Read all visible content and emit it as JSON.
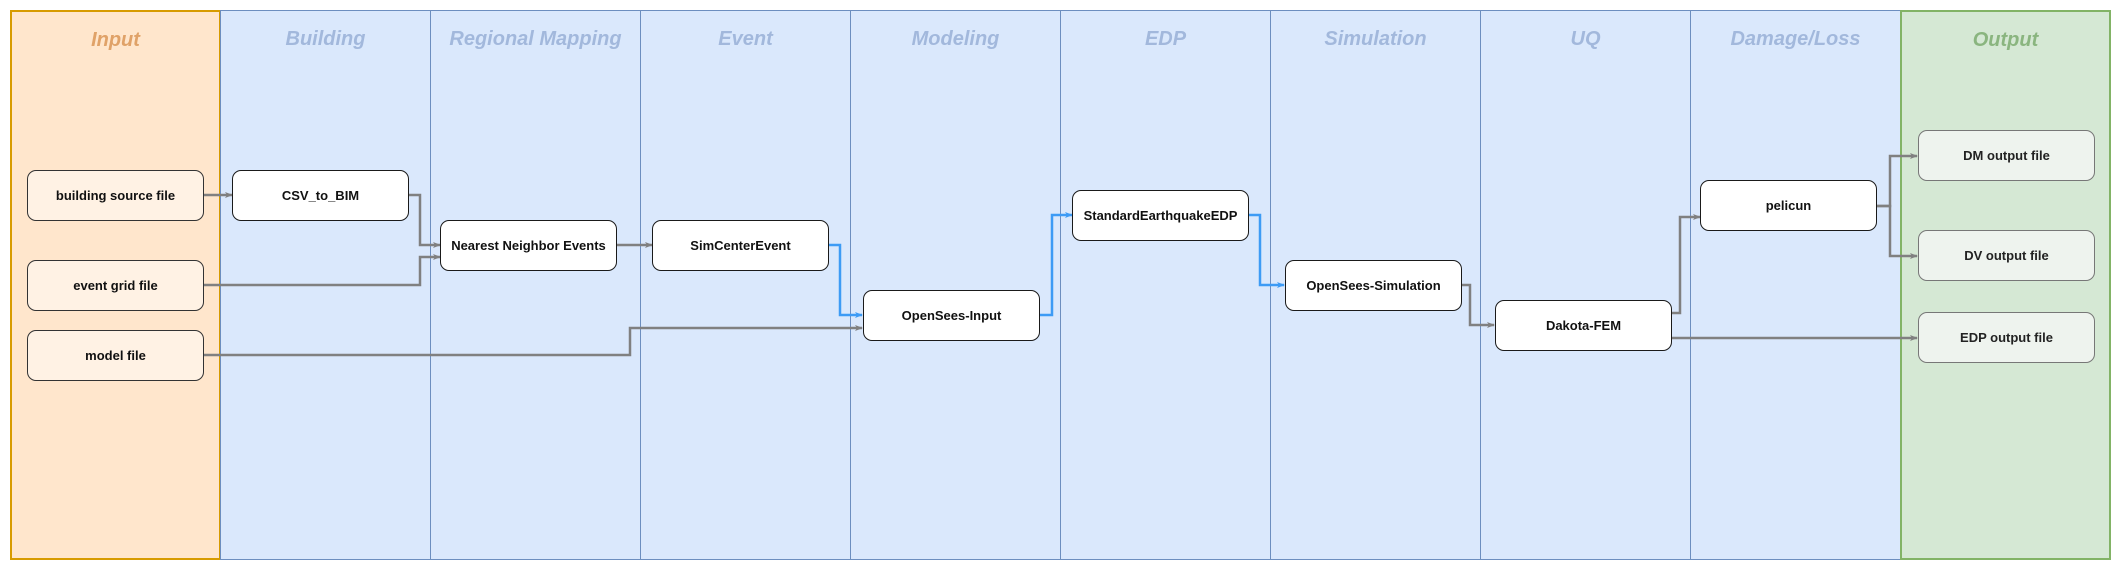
{
  "colors": {
    "flow_gray": "#808080",
    "flow_blue": "#3d9bf5",
    "lane_blue_fill": "#dae8fc",
    "lane_input_fill": "#ffe6cc",
    "lane_output_fill": "#d5e8d4"
  },
  "lanes": [
    {
      "id": "input",
      "title": "Input"
    },
    {
      "id": "building",
      "title": "Building"
    },
    {
      "id": "regional-mapping",
      "title": "Regional Mapping"
    },
    {
      "id": "event",
      "title": "Event"
    },
    {
      "id": "modeling",
      "title": "Modeling"
    },
    {
      "id": "edp",
      "title": "EDP"
    },
    {
      "id": "simulation",
      "title": "Simulation"
    },
    {
      "id": "uq",
      "title": "UQ"
    },
    {
      "id": "damage-loss",
      "title": "Damage/Loss"
    },
    {
      "id": "output",
      "title": "Output"
    }
  ],
  "nodes": {
    "building_source_file": "building source file",
    "event_grid_file": "event grid file",
    "model_file": "model file",
    "csv_to_bim": "CSV_to_BIM",
    "nearest_neighbor_events": "Nearest Neighbor Events",
    "simcenter_event": "SimCenterEvent",
    "opensees_input": "OpenSees-Input",
    "standard_earthquake_edp": "StandardEarthquakeEDP",
    "opensees_simulation": "OpenSees-Simulation",
    "dakota_fem": "Dakota-FEM",
    "pelicun": "pelicun",
    "dm_output_file": "DM output file",
    "dv_output_file": "DV output file",
    "edp_output_file": "EDP output file"
  },
  "edges": [
    {
      "from": "building source file",
      "to": "CSV_to_BIM",
      "style": "gray"
    },
    {
      "from": "CSV_to_BIM",
      "to": "Nearest Neighbor Events",
      "style": "gray"
    },
    {
      "from": "event grid file",
      "to": "Nearest Neighbor Events",
      "style": "gray"
    },
    {
      "from": "Nearest Neighbor Events",
      "to": "SimCenterEvent",
      "style": "gray"
    },
    {
      "from": "SimCenterEvent",
      "to": "OpenSees-Input",
      "style": "blue"
    },
    {
      "from": "model file",
      "to": "OpenSees-Input",
      "style": "gray"
    },
    {
      "from": "OpenSees-Input",
      "to": "StandardEarthquakeEDP",
      "style": "blue"
    },
    {
      "from": "StandardEarthquakeEDP",
      "to": "OpenSees-Simulation",
      "style": "blue"
    },
    {
      "from": "OpenSees-Simulation",
      "to": "Dakota-FEM",
      "style": "gray"
    },
    {
      "from": "Dakota-FEM",
      "to": "pelicun",
      "style": "gray"
    },
    {
      "from": "Dakota-FEM",
      "to": "EDP output file",
      "style": "gray"
    },
    {
      "from": "pelicun",
      "to": "DM output file",
      "style": "gray"
    },
    {
      "from": "pelicun",
      "to": "DV output file",
      "style": "gray"
    }
  ]
}
